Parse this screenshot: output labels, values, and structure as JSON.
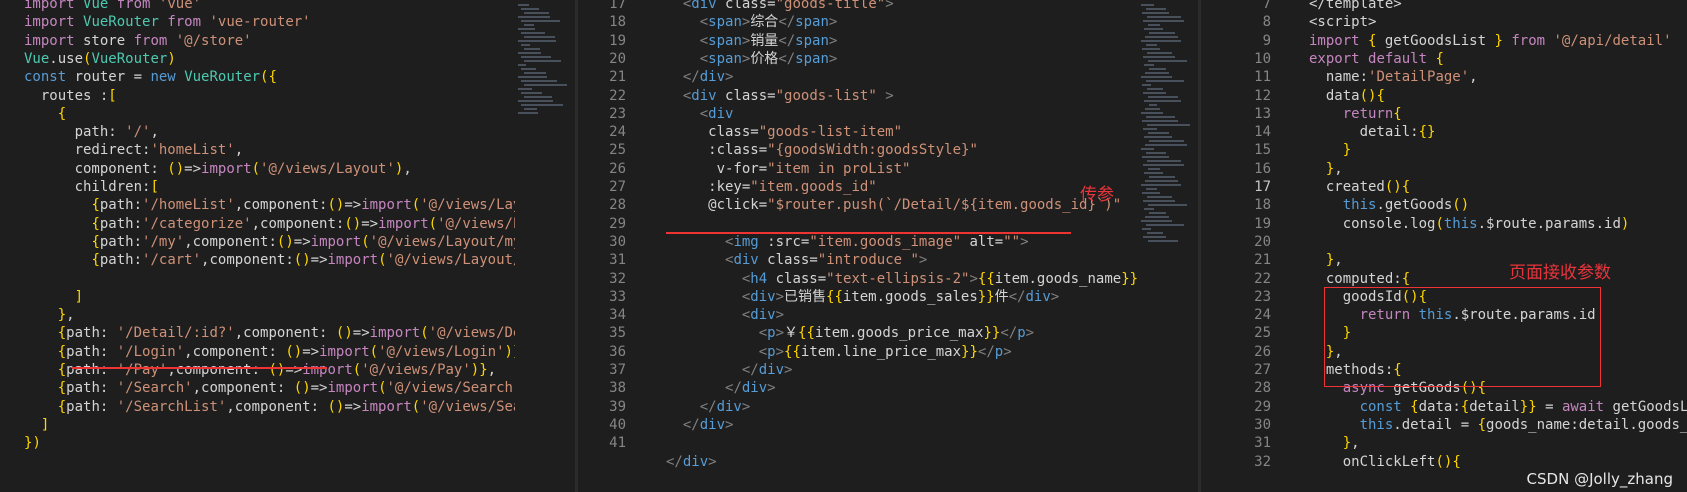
{
  "left_pane": {
    "lines": [
      "import Vue from 'vue'",
      "import VueRouter from 'vue-router'",
      "import store from '@/store'",
      "Vue.use(VueRouter)",
      "const router = new VueRouter({",
      "  routes :[",
      "    {",
      "      path: '/',",
      "      redirect:'homeList',",
      "      component: ()=>import('@/views/Layout'),",
      "      children:[",
      "        {path:'/homeList',component:()=>import('@/views/Layou",
      "        {path:'/categorize',component:()=>import('@/views/Lay",
      "        {path:'/my',component:()=>import('@/views/Layout/my'",
      "        {path:'/cart',component:()=>import('@/views/Layout/ca",
      "",
      "      ]",
      "    },",
      "    {path: '/Detail/:id?',component: ()=>import('@/views/Deta",
      "    {path: '/Login',component: ()=>import('@/views/Login')},",
      "    {path: '/Pay',component: ()=>import('@/views/Pay')},",
      "    {path: '/Search',component: ()=>import('@/views/Search')",
      "    {path: '/SearchList',component: ()=>import('@/views/Sear",
      "  ]",
      "})"
    ]
  },
  "middle_pane": {
    "line_numbers": [
      "17",
      "18",
      "19",
      "20",
      "21",
      "22",
      "23",
      "24",
      "25",
      "26",
      "27",
      "28",
      "29",
      "30",
      "31",
      "32",
      "33",
      "34",
      "35",
      "36",
      "37",
      "38",
      "39",
      "40",
      "41"
    ],
    "lines": [
      "  <div class=\"goods-title\">",
      "    <span>综合</span>",
      "    <span>销量</span>",
      "    <span>价格</span>",
      "  </div>",
      "  <div class=\"goods-list\" >",
      "    <div",
      "     class=\"goods-list-item\"",
      "     :class=\"{goodsWidth:goodsStyle}\"",
      "      v-for=\"item in proList\"",
      "     :key=\"item.goods_id\"",
      "     @click=\"$router.push(`/Detail/${item.goods_id}`)\"",
      "",
      "       <img :src=\"item.goods_image\" alt=\"\">",
      "       <div class=\"introduce \">",
      "         <h4 class=\"text-ellipsis-2\">{{item.goods_name}}</h4>",
      "         <div>已销售{{item.goods_sales}}件</div>",
      "         <div>",
      "           <p>￥{{item.goods_price_max}}</p>",
      "           <p>{{item.line_price_max}}</p>",
      "         </div>",
      "       </div>",
      "    </div>",
      "  </div>",
      "",
      "</div>"
    ],
    "annotation": "传参"
  },
  "right_pane": {
    "line_numbers": [
      "7",
      "8",
      "9",
      "10",
      "11",
      "12",
      "13",
      "14",
      "15",
      "16",
      "17",
      "18",
      "19",
      "20",
      "21",
      "22",
      "23",
      "24",
      "25",
      "26",
      "27",
      "28",
      "29",
      "30",
      "31",
      "32"
    ],
    "active_line": "17",
    "lines": [
      "</template>",
      "<script>",
      "import { getGoodsList } from '@/api/detail'",
      "export default {",
      "  name:'DetailPage',",
      "  data(){",
      "    return{",
      "      detail:{}",
      "    }",
      "  },",
      "  created(){",
      "    this.getGoods()",
      "    console.log(this.$route.params.id)",
      "",
      "  },",
      "  computed:{",
      "    goodsId(){",
      "      return this.$route.params.id",
      "    }",
      "  },",
      "  methods:{",
      "    async getGoods(){",
      "      const {data:{detail}} = await getGoodsLis",
      "      this.detail = {goods_name:detail.goods_na",
      "    },",
      "    onClickLeft(){"
    ],
    "annotation": "页面接收参数"
  },
  "watermark": "CSDN @Jolly_zhang",
  "colors": {
    "background": "#1e1e1e",
    "annotation_red": "#e8343b"
  }
}
